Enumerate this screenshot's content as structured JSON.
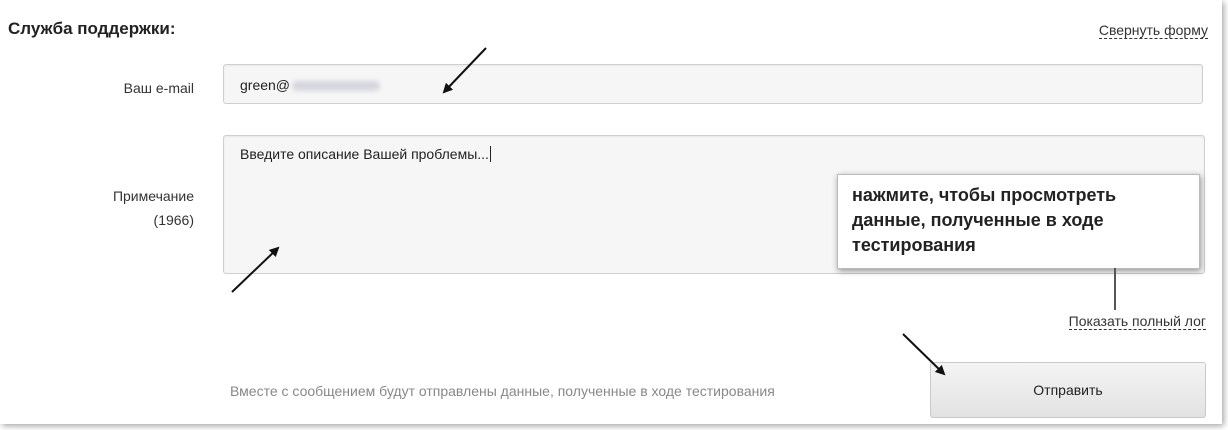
{
  "header": {
    "title": "Служба поддержки:",
    "collapse_label": "Свернуть форму"
  },
  "form": {
    "email_label": "Ваш e-mail",
    "email_value": "green@",
    "note_label": "Примечание",
    "note_counter": "(1966)",
    "note_value": "Введите описание Вашей проблемы..."
  },
  "tooltip": {
    "text": "нажмите, чтобы просмотреть данные, полученные в ходе тестирования"
  },
  "links": {
    "show_log": "Показать полный лог"
  },
  "footer": {
    "info_text": "Вместе с сообщением будут отправлены данные, полученные в ходе тестирования",
    "send_label": "Отправить"
  }
}
